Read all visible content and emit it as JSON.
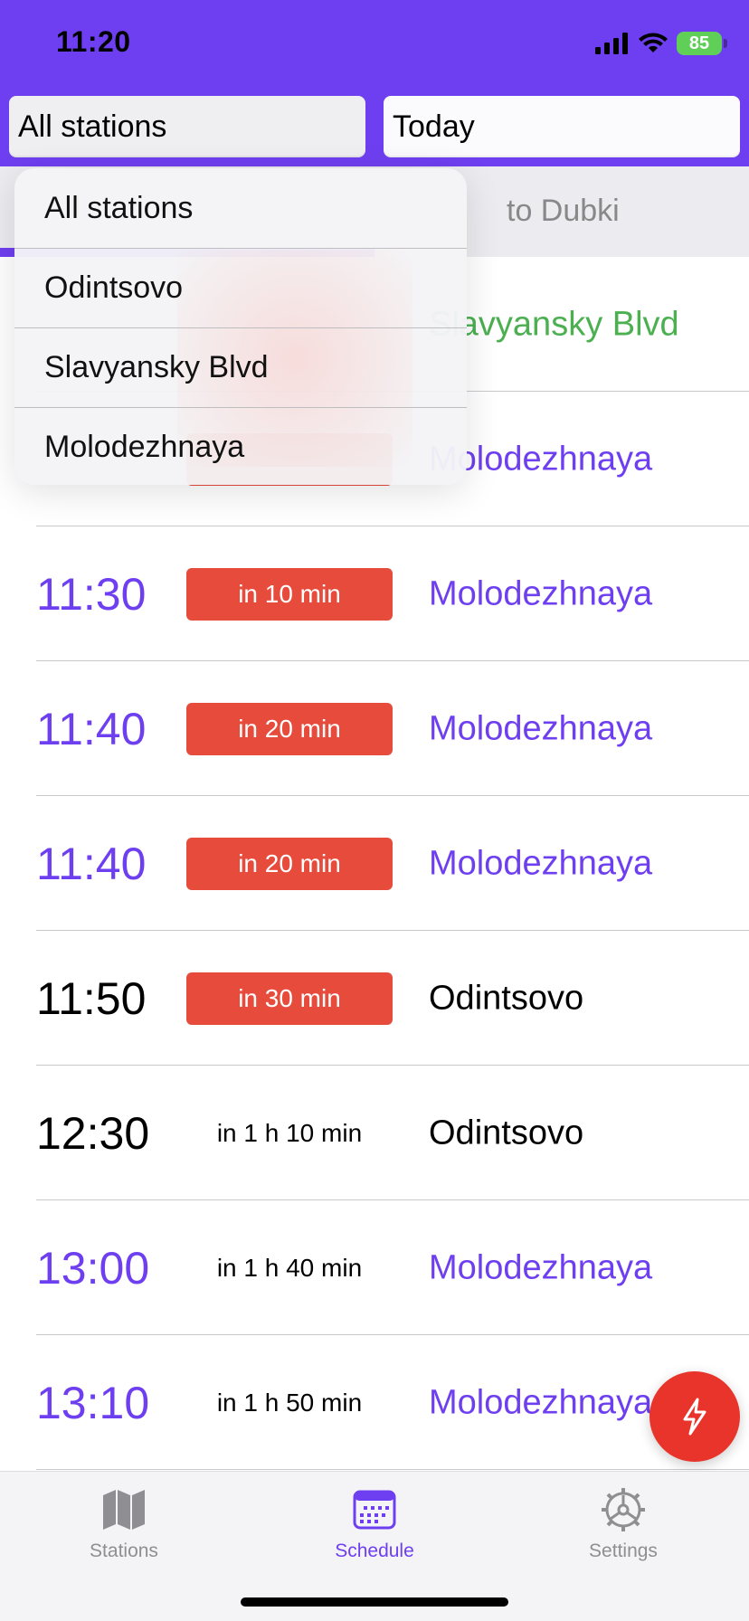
{
  "status_bar": {
    "time": "11:20",
    "battery": "85"
  },
  "header": {
    "station_selector": "All stations",
    "day_selector": "Today"
  },
  "direction_tabs": {
    "right_label": "to Dubki"
  },
  "dropdown": {
    "options": [
      "All stations",
      "Odintsovo",
      "Slavyansky Blvd",
      "Molodezhnaya"
    ]
  },
  "schedule": [
    {
      "time": "",
      "countdown": "",
      "destination": "Slavyansky Blvd",
      "color": "#4caf50",
      "badge": "none"
    },
    {
      "time": "",
      "countdown": "",
      "destination": "Molodezhnaya",
      "color": "#6e3ff0",
      "badge": "red"
    },
    {
      "time": "11:30",
      "countdown": "in 10 min",
      "destination": "Molodezhnaya",
      "color": "#6e3ff0",
      "badge": "red"
    },
    {
      "time": "11:40",
      "countdown": "in 20 min",
      "destination": "Molodezhnaya",
      "color": "#6e3ff0",
      "badge": "red"
    },
    {
      "time": "11:40",
      "countdown": "in 20 min",
      "destination": "Molodezhnaya",
      "color": "#6e3ff0",
      "badge": "red"
    },
    {
      "time": "11:50",
      "countdown": "in 30 min",
      "destination": "Odintsovo",
      "color": "#000000",
      "badge": "red"
    },
    {
      "time": "12:30",
      "countdown": "in 1 h 10 min",
      "destination": "Odintsovo",
      "color": "#000000",
      "badge": "plain"
    },
    {
      "time": "13:00",
      "countdown": "in 1 h 40 min",
      "destination": "Molodezhnaya",
      "color": "#6e3ff0",
      "badge": "plain"
    },
    {
      "time": "13:10",
      "countdown": "in 1 h 50 min",
      "destination": "Molodezhnaya",
      "color": "#6e3ff0",
      "badge": "plain"
    }
  ],
  "fab": {
    "icon": "lightning-icon"
  },
  "tabbar": {
    "items": [
      {
        "label": "Stations",
        "icon": "map-icon"
      },
      {
        "label": "Schedule",
        "icon": "calendar-icon"
      },
      {
        "label": "Settings",
        "icon": "gear-icon"
      }
    ],
    "active": "Schedule"
  },
  "colors": {
    "accent": "#6e3ff0",
    "badge_red": "#e64b3c",
    "fab_red": "#e8342a",
    "green": "#4caf50"
  }
}
